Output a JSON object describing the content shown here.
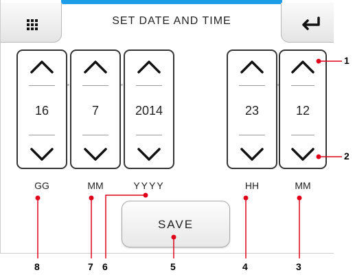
{
  "header": {
    "title": "SET DATE AND TIME"
  },
  "icons": {
    "menu": "grid-icon",
    "enter": "enter-arrow-icon"
  },
  "spinners": [
    {
      "value": "16",
      "unit": "GG"
    },
    {
      "value": "7",
      "unit": "MM"
    },
    {
      "value": "2014",
      "unit": "YYYY"
    },
    {
      "value": "23",
      "unit": "HH"
    },
    {
      "value": "12",
      "unit": "MM"
    }
  ],
  "save": {
    "label": "SAVE"
  },
  "callouts": [
    "1",
    "2",
    "3",
    "4",
    "5",
    "6",
    "7",
    "8"
  ],
  "colors": {
    "accent": "#1e9ee6",
    "callout": "#e0001a"
  }
}
